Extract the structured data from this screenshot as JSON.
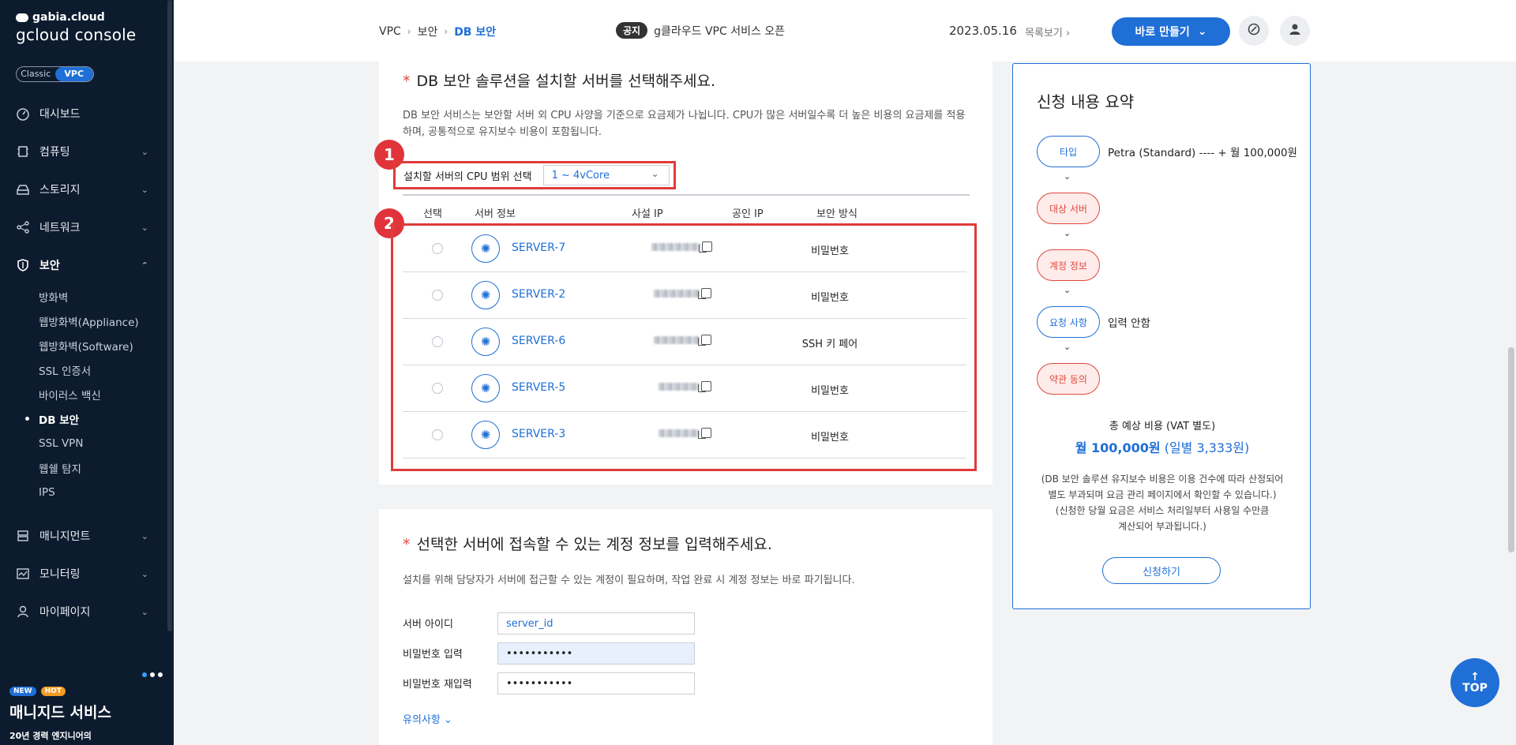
{
  "brand": {
    "top": "gabia.cloud",
    "bottom": "gcloud console"
  },
  "toggle": {
    "off": "Classic",
    "on": "VPC"
  },
  "nav": [
    {
      "label": "대시보드",
      "icon": "dashboard-icon",
      "chevron": ""
    },
    {
      "label": "컴퓨팅",
      "icon": "cpu-icon",
      "chevron": "⌄"
    },
    {
      "label": "스토리지",
      "icon": "storage-icon",
      "chevron": "⌄"
    },
    {
      "label": "네트워크",
      "icon": "network-icon",
      "chevron": "⌄"
    },
    {
      "label": "보안",
      "icon": "shield-icon",
      "chevron": "⌃"
    },
    {
      "label": "매니지먼트",
      "icon": "management-icon",
      "chevron": "⌄"
    },
    {
      "label": "모니터링",
      "icon": "monitoring-icon",
      "chevron": "⌄"
    },
    {
      "label": "마이페이지",
      "icon": "user-icon",
      "chevron": "⌄"
    }
  ],
  "security_sub": [
    "방화벽",
    "웹방화벽(Appliance)",
    "웹방화벽(Software)",
    "SSL 인증서",
    "바이러스 백신",
    "DB 보안",
    "SSL VPN",
    "웹쉘 탐지",
    "IPS"
  ],
  "promo": {
    "badge_new": "NEW",
    "badge_hot": "HOT",
    "title": "매니지드 서비스",
    "subtitle": "20년 경력 엔지니어의"
  },
  "header": {
    "crumbs": [
      "VPC",
      "보안",
      "DB 보안"
    ],
    "notice_tag": "공지",
    "notice_text": "g클라우드 VPC 서비스 오픈",
    "date": "2023.05.16",
    "list_link": "목록보기 ›",
    "create_label": "바로 만들기"
  },
  "section1": {
    "title": "DB 보안 솔루션을 설치할 서버를 선택해주세요.",
    "desc": "DB 보안 서비스는 보안할 서버 외 CPU 사양을 기준으로 요금제가 나뉩니다. CPU가 많은 서버일수록 더 높은 비용의 요금제를 적용하며, 공통적으로 유지보수 비용이 포함됩니다.",
    "cpu_label": "설치할 서버의 CPU 범위 선택",
    "cpu_value": "1 ~ 4vCore",
    "marker1": "1",
    "marker2": "2",
    "columns": {
      "select": "선택",
      "server": "서버 정보",
      "private_ip": "사설 IP",
      "public_ip": "공인 IP",
      "security": "보안 방식"
    },
    "rows": [
      {
        "name": "SERVER-7",
        "security": "비밀번호"
      },
      {
        "name": "SERVER-2",
        "security": "비밀번호"
      },
      {
        "name": "SERVER-6",
        "security": "SSH 키 페어"
      },
      {
        "name": "SERVER-5",
        "security": "비밀번호"
      },
      {
        "name": "SERVER-3",
        "security": "비밀번호"
      }
    ]
  },
  "section2": {
    "title": "선택한 서버에 접속할 수 있는 계정 정보를 입력해주세요.",
    "desc": "설치를 위해 담당자가 서버에 접근할 수 있는 계정이 필요하며, 작업 완료 시 계정 정보는 바로 파기됩니다.",
    "id_label": "서버 아이디",
    "id_value": "server_id",
    "pw_label": "비밀번호 입력",
    "pw_value": "•••••••••••",
    "pw2_label": "비밀번호 재입력",
    "pw2_value": "•••••••••••",
    "notes_link": "유의사항 ⌄"
  },
  "summary": {
    "title": "신청 내용 요약",
    "steps": [
      {
        "label": "타입",
        "value": "Petra (Standard) ---- + 월 100,000원"
      },
      {
        "label": "대상 서버",
        "value": ""
      },
      {
        "label": "계정 정보",
        "value": ""
      },
      {
        "label": "요청 사항",
        "value": "입력 안함"
      },
      {
        "label": "약관 동의",
        "value": ""
      }
    ],
    "arrow": "⌄",
    "cost_label": "총 예상 비용 (VAT 별도)",
    "cost_main": "월 100,000원",
    "cost_daily": "(일별 3,333원)",
    "note_lines": [
      "(DB 보안 솔루션 유지보수 비용은 이용 건수에 따라 산정되어",
      "별도 부과되며 요금 관리 페이지에서 확인할 수 있습니다.)",
      "(신청한 당월 요금은 서비스 처리일부터 사용일 수만큼",
      "계산되어 부과됩니다.)"
    ],
    "apply_label": "신청하기"
  },
  "top_button": "TOP",
  "colors": {
    "accent": "#1f6fd6",
    "highlight": "#e03a3a",
    "sidebar": "#0d1b2e"
  }
}
